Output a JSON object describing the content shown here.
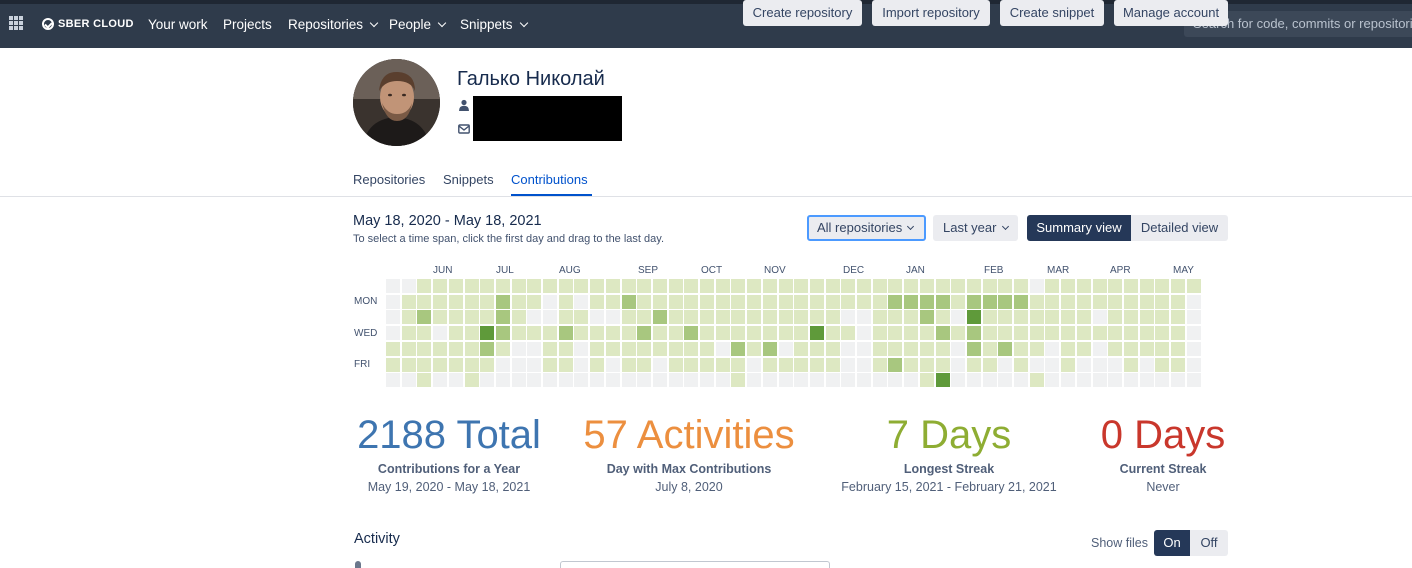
{
  "topbar": {
    "logo": "SBER CLOUD",
    "nav": [
      {
        "label": "Your work",
        "dropdown": false
      },
      {
        "label": "Projects",
        "dropdown": false
      },
      {
        "label": "Repositories",
        "dropdown": true
      },
      {
        "label": "People",
        "dropdown": true
      },
      {
        "label": "Snippets",
        "dropdown": true
      }
    ],
    "search_placeholder": "Search for code, commits or repositories"
  },
  "profile": {
    "name": "Галько Николай",
    "icons": [
      "user-icon",
      "email-icon"
    ]
  },
  "actions": {
    "create_repository": "Create repository",
    "import_repository": "Import repository",
    "create_snippet": "Create snippet",
    "manage_account": "Manage account"
  },
  "tabs": [
    {
      "label": "Repositories",
      "active": false
    },
    {
      "label": "Snippets",
      "active": false
    },
    {
      "label": "Contributions",
      "active": true
    }
  ],
  "range": {
    "title": "May 18, 2020 - May 18, 2021",
    "hint": "To select a time span, click the first day and drag to the last day."
  },
  "filters": {
    "repositories": "All repositories",
    "period": "Last year",
    "summary_view": "Summary view",
    "detailed_view": "Detailed view",
    "active_view": "summary"
  },
  "heatmap": {
    "months": [
      "JUN",
      "JUL",
      "AUG",
      "SEP",
      "OCT",
      "NOV",
      "DEC",
      "JAN",
      "FEB",
      "MAR",
      "APR",
      "MAY"
    ],
    "day_labels": [
      "MON",
      "WED",
      "FRI"
    ],
    "weeks": [
      [
        0,
        0,
        0,
        0,
        1,
        1,
        0
      ],
      [
        0,
        1,
        1,
        1,
        1,
        1,
        0
      ],
      [
        1,
        1,
        2,
        1,
        1,
        1,
        1
      ],
      [
        1,
        1,
        1,
        0,
        1,
        1,
        0
      ],
      [
        1,
        1,
        1,
        1,
        1,
        1,
        0
      ],
      [
        1,
        1,
        1,
        1,
        1,
        1,
        1
      ],
      [
        1,
        1,
        1,
        3,
        2,
        1,
        0
      ],
      [
        1,
        2,
        2,
        2,
        1,
        0,
        0
      ],
      [
        1,
        1,
        1,
        1,
        0,
        0,
        0
      ],
      [
        1,
        1,
        0,
        1,
        0,
        0,
        0
      ],
      [
        1,
        0,
        0,
        1,
        1,
        1,
        0
      ],
      [
        1,
        1,
        1,
        2,
        1,
        1,
        0
      ],
      [
        1,
        0,
        1,
        1,
        0,
        0,
        0
      ],
      [
        1,
        1,
        0,
        1,
        1,
        1,
        0
      ],
      [
        1,
        1,
        0,
        1,
        1,
        0,
        0
      ],
      [
        1,
        2,
        1,
        1,
        1,
        1,
        0
      ],
      [
        1,
        1,
        1,
        2,
        1,
        1,
        0
      ],
      [
        1,
        1,
        2,
        1,
        1,
        0,
        0
      ],
      [
        1,
        1,
        1,
        1,
        1,
        1,
        0
      ],
      [
        1,
        1,
        1,
        2,
        1,
        1,
        0
      ],
      [
        1,
        1,
        1,
        1,
        1,
        1,
        0
      ],
      [
        1,
        1,
        1,
        1,
        0,
        1,
        0
      ],
      [
        1,
        1,
        1,
        1,
        2,
        1,
        1
      ],
      [
        1,
        1,
        1,
        1,
        1,
        0,
        0
      ],
      [
        1,
        1,
        1,
        1,
        2,
        1,
        0
      ],
      [
        1,
        1,
        1,
        1,
        0,
        1,
        0
      ],
      [
        1,
        1,
        1,
        1,
        1,
        1,
        0
      ],
      [
        1,
        1,
        1,
        3,
        1,
        1,
        0
      ],
      [
        1,
        1,
        1,
        1,
        1,
        1,
        0
      ],
      [
        1,
        1,
        0,
        1,
        0,
        0,
        0
      ],
      [
        1,
        1,
        0,
        0,
        0,
        0,
        0
      ],
      [
        1,
        1,
        1,
        1,
        1,
        1,
        0
      ],
      [
        1,
        2,
        1,
        1,
        1,
        2,
        0
      ],
      [
        1,
        2,
        1,
        1,
        1,
        1,
        0
      ],
      [
        1,
        2,
        2,
        1,
        1,
        1,
        1
      ],
      [
        1,
        2,
        1,
        2,
        1,
        1,
        3
      ],
      [
        1,
        1,
        0,
        1,
        0,
        0,
        0
      ],
      [
        1,
        2,
        3,
        2,
        2,
        1,
        0
      ],
      [
        1,
        2,
        1,
        1,
        1,
        1,
        0
      ],
      [
        1,
        2,
        1,
        1,
        2,
        0,
        0
      ],
      [
        1,
        2,
        1,
        1,
        1,
        1,
        0
      ],
      [
        0,
        1,
        1,
        1,
        1,
        0,
        1
      ],
      [
        1,
        1,
        1,
        1,
        0,
        0,
        0
      ],
      [
        1,
        1,
        1,
        1,
        1,
        1,
        0
      ],
      [
        1,
        1,
        1,
        1,
        1,
        0,
        0
      ],
      [
        1,
        1,
        0,
        1,
        0,
        0,
        0
      ],
      [
        1,
        1,
        1,
        1,
        1,
        0,
        0
      ],
      [
        1,
        1,
        1,
        1,
        1,
        1,
        0
      ],
      [
        1,
        1,
        1,
        1,
        1,
        0,
        0
      ],
      [
        1,
        1,
        1,
        1,
        1,
        1,
        0
      ],
      [
        1,
        1,
        1,
        1,
        1,
        1,
        0
      ],
      [
        1,
        0,
        0,
        0,
        0,
        0,
        0
      ]
    ],
    "colors": [
      "#f0f1f2",
      "#dde8c2",
      "#a8c77f",
      "#5f9a3a"
    ]
  },
  "stats": [
    {
      "number": "2188 Total",
      "label": "Contributions for a Year",
      "sub": "May 19, 2020 - May 18, 2021",
      "color": "#3e75b0"
    },
    {
      "number": "57 Activities",
      "label": "Day with Max Contributions",
      "sub": "July 8, 2020",
      "color": "#ec8f3f"
    },
    {
      "number": "7 Days",
      "label": "Longest Streak",
      "sub": "February 15, 2021 - February 21, 2021",
      "color": "#8ead33"
    },
    {
      "number": "0 Days",
      "label": "Current Streak",
      "sub": "Never",
      "color": "#c9372c"
    }
  ],
  "activity": {
    "title": "Activity",
    "show_files_label": "Show files",
    "on_label": "On",
    "off_label": "Off",
    "show_files": true
  },
  "colors": {
    "topbar": "#2f3b4b",
    "primary_dark": "#253858",
    "link": "#0052cc",
    "button_bg": "#ebecf0"
  }
}
